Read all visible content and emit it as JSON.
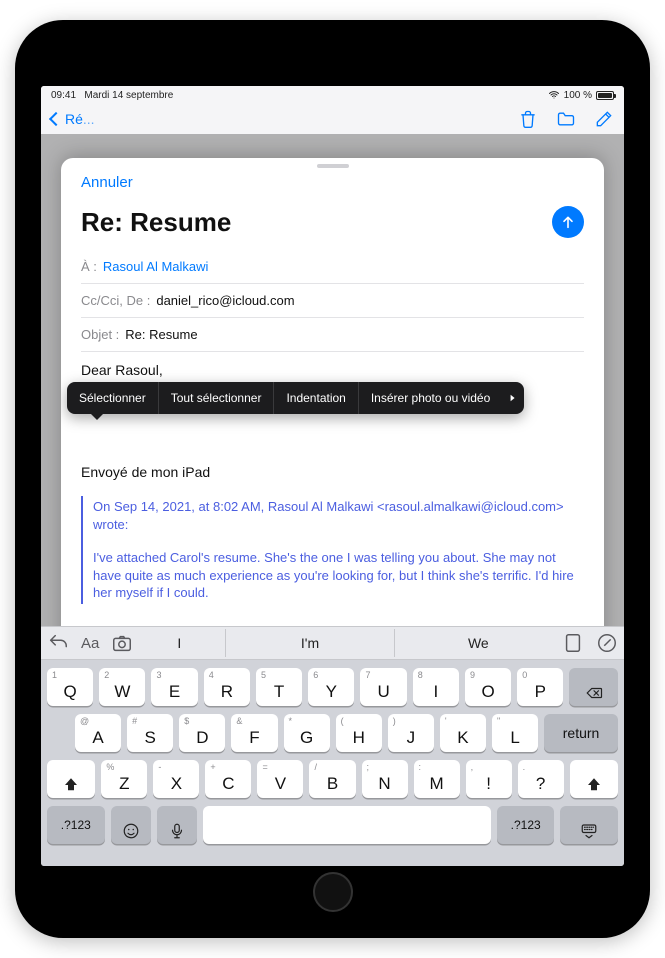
{
  "status": {
    "time": "09:41",
    "date": "Mardi 14 septembre",
    "battery_pct": "100 %"
  },
  "background_toolbar": {
    "back_label": "Ré"
  },
  "compose": {
    "cancel_label": "Annuler",
    "title": "Re: Resume",
    "to_label": "À :",
    "to_value": "Rasoul Al Malkawi",
    "cc_label": "Cc/Cci, De :",
    "cc_value": "daniel_rico@icloud.com",
    "subject_label": "Objet :",
    "subject_value": "Re: Resume",
    "greeting": "Dear Rasoul,",
    "signature": "Envoyé de mon iPad",
    "quote_attrib": "On Sep 14, 2021, at 8:02 AM, Rasoul Al Malkawi <rasoul.almalkawi@icloud.com> wrote:",
    "quote_body": "I've attached Carol's resume. She's the one I was telling you about. She may not have quite as much experience as you're looking for, but I think she's terrific. I'd hire her myself if I could."
  },
  "context_menu": {
    "items": [
      "Sélectionner",
      "Tout sélectionner",
      "Indentation",
      "Insérer photo ou vidéo"
    ]
  },
  "keyboard": {
    "suggestions": [
      "I",
      "I'm",
      "We"
    ],
    "row1": [
      {
        "k": "Q",
        "h": "1"
      },
      {
        "k": "W",
        "h": "2"
      },
      {
        "k": "E",
        "h": "3"
      },
      {
        "k": "R",
        "h": "4"
      },
      {
        "k": "T",
        "h": "5"
      },
      {
        "k": "Y",
        "h": "6"
      },
      {
        "k": "U",
        "h": "7"
      },
      {
        "k": "I",
        "h": "8"
      },
      {
        "k": "O",
        "h": "9"
      },
      {
        "k": "P",
        "h": "0"
      }
    ],
    "row2": [
      {
        "k": "A",
        "h": "@"
      },
      {
        "k": "S",
        "h": "#"
      },
      {
        "k": "D",
        "h": "$"
      },
      {
        "k": "F",
        "h": "&"
      },
      {
        "k": "G",
        "h": "*"
      },
      {
        "k": "H",
        "h": "("
      },
      {
        "k": "J",
        "h": ")"
      },
      {
        "k": "K",
        "h": "'"
      },
      {
        "k": "L",
        "h": "\""
      }
    ],
    "row3": [
      {
        "k": "Z",
        "h": "%"
      },
      {
        "k": "X",
        "h": "-"
      },
      {
        "k": "C",
        "h": "+"
      },
      {
        "k": "V",
        "h": "="
      },
      {
        "k": "B",
        "h": "/"
      },
      {
        "k": "N",
        "h": ";"
      },
      {
        "k": "M",
        "h": ":"
      },
      {
        "k": "!",
        "h": ","
      },
      {
        "k": "?",
        "h": "."
      }
    ],
    "return_label": "return",
    "numsym_label": ".?123"
  }
}
